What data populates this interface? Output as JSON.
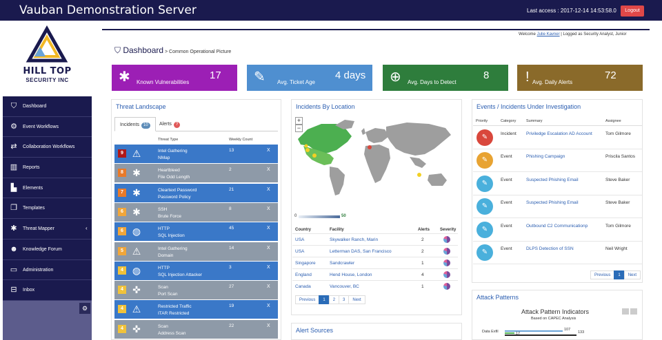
{
  "header": {
    "title": "Vauban Demonstration Server",
    "last_access": "Last access : 2017-12-14 14:53:58.0",
    "logout_label": "Logout"
  },
  "logo": {
    "line1": "HILL TOP",
    "line2": "SECURITY INC"
  },
  "sidebar": {
    "items": [
      {
        "label": "Dashboard",
        "icon": "shield-icon"
      },
      {
        "label": "Event Workflows",
        "icon": "cogs-icon"
      },
      {
        "label": "Collaboration Workflows",
        "icon": "exchange-icon"
      },
      {
        "label": "Reports",
        "icon": "bar-chart-icon"
      },
      {
        "label": "Elements",
        "icon": "sitemap-icon"
      },
      {
        "label": "Templates",
        "icon": "copy-icon"
      },
      {
        "label": "Threat Mapper",
        "icon": "bug-icon"
      },
      {
        "label": "Knowledge Forum",
        "icon": "users-icon"
      },
      {
        "label": "Administration",
        "icon": "desktop-icon"
      },
      {
        "label": "Inbox",
        "icon": "inbox-icon"
      }
    ]
  },
  "welcome": {
    "prefix": "Welcome ",
    "user": "Julie Kavner",
    "suffix": " | Logged as Security Analyst, Junior"
  },
  "breadcrumb": {
    "title": "Dashboard",
    "sub": " > Common Operational Picture"
  },
  "tiles": [
    {
      "label": "Known Vulnerabilities",
      "value": "17",
      "color": "#9c1fb5",
      "icon": "bug-icon"
    },
    {
      "label": "Avg. Ticket Age",
      "value": "4 days",
      "color": "#4f8fd0",
      "icon": "ticket-icon"
    },
    {
      "label": "Avg. Days to Detect",
      "value": "8",
      "color": "#2e7d3c",
      "icon": "search-plus-icon"
    },
    {
      "label": "Avg. Daily Alerts",
      "value": "72",
      "color": "#8a6a2a",
      "icon": "exclamation-icon"
    }
  ],
  "threat_landscape": {
    "title": "Threat Landscape",
    "tabs": [
      {
        "label": "Incidents",
        "badge": "10"
      },
      {
        "label": "Alerts",
        "badge": "?"
      }
    ],
    "col_threat_type": "Threat Type",
    "col_weekly_count": "Weekly Count",
    "rows": [
      {
        "num": "9",
        "line1": "Intel Gathering",
        "line2": "NMap",
        "count": "13",
        "row_color": "#3a78c8",
        "num_color": "#b01818",
        "icon": "warning-icon"
      },
      {
        "num": "8",
        "line1": "Heartbleed",
        "line2": "File Odd Length",
        "count": "2",
        "row_color": "#8e9aa8",
        "num_color": "#e87a2a",
        "icon": "bug-icon"
      },
      {
        "num": "7",
        "line1": "Cleartext Password",
        "line2": "Password Policy",
        "count": "21",
        "row_color": "#3a78c8",
        "num_color": "#e87a2a",
        "icon": "asterisk-icon"
      },
      {
        "num": "6",
        "line1": "SSH",
        "line2": "Brute Force",
        "count": "8",
        "row_color": "#8e9aa8",
        "num_color": "#f0a63a",
        "icon": "asterisk-icon"
      },
      {
        "num": "6",
        "line1": "HTTP",
        "line2": "SQL Injection",
        "count": "45",
        "row_color": "#3a78c8",
        "num_color": "#f0a63a",
        "icon": "globe-icon"
      },
      {
        "num": "5",
        "line1": "Intel Gathering",
        "line2": "Domain",
        "count": "14",
        "row_color": "#8e9aa8",
        "num_color": "#f0a63a",
        "icon": "warning-icon"
      },
      {
        "num": "4",
        "line1": "HTTP",
        "line2": "SQL Injection Attacker",
        "count": "3",
        "row_color": "#3a78c8",
        "num_color": "#f0c23a",
        "icon": "globe-icon"
      },
      {
        "num": "4",
        "line1": "Scan",
        "line2": "Port Scan",
        "count": "27",
        "row_color": "#8e9aa8",
        "num_color": "#f0c23a",
        "icon": "crosshairs-icon"
      },
      {
        "num": "4",
        "line1": "Restricted Traffic",
        "line2": "ITAR Restricted",
        "count": "19",
        "row_color": "#3a78c8",
        "num_color": "#f0c23a",
        "icon": "warning-icon"
      },
      {
        "num": "4",
        "line1": "Scan",
        "line2": "Address Scan",
        "count": "22",
        "row_color": "#8e9aa8",
        "num_color": "#f0c23a",
        "icon": "crosshairs-icon"
      }
    ],
    "close_glyph": "X"
  },
  "incidents_by_location": {
    "title": "Incidents By Location",
    "zoom_in": "+",
    "zoom_out": "−",
    "legend_min": "0",
    "legend_max": "50",
    "columns": [
      "Country",
      "Facility",
      "Alerts",
      "Severity"
    ],
    "rows": [
      {
        "country": "USA",
        "facility": "Skywalker Ranch, Marin",
        "alerts": "2"
      },
      {
        "country": "USA",
        "facility": "Letterman DAS, San Francisco",
        "alerts": "2"
      },
      {
        "country": "Singapore",
        "facility": "Sandcrawler",
        "alerts": "1"
      },
      {
        "country": "England",
        "facility": "Hend House, London",
        "alerts": "4"
      },
      {
        "country": "Canada",
        "facility": "Vancouver, BC",
        "alerts": "1"
      }
    ],
    "pager": {
      "prev": "Previous",
      "pages": [
        "1",
        "2",
        "3"
      ],
      "next": "Next"
    }
  },
  "alert_sources": {
    "title": "Alert Sources"
  },
  "events": {
    "title": "Events / Incidents Under Investigation",
    "columns": [
      "Priority",
      "Category",
      "Summary",
      "Assignee"
    ],
    "rows": [
      {
        "category": "Incident",
        "summary": "Priviledge Escalation AD Account",
        "assignee": "Tom Gilmore",
        "color": "#d9473c"
      },
      {
        "category": "Event",
        "summary": "Phishing Campaign",
        "assignee": "Priscila Santos",
        "color": "#e8a332"
      },
      {
        "category": "Event",
        "summary": "Suspected Phishing Email",
        "assignee": "Steve Baker",
        "color": "#4ab0dc"
      },
      {
        "category": "Event",
        "summary": "Suspected Phishing Email",
        "assignee": "Steve Baker",
        "color": "#4ab0dc"
      },
      {
        "category": "Event",
        "summary": "Outbound C2 Communicationp",
        "assignee": "Tom Gilmore",
        "color": "#4ab0dc"
      },
      {
        "category": "Event",
        "summary": "DLPS Detection of SSN",
        "assignee": "Neil Wright",
        "color": "#4ab0dc"
      }
    ],
    "pager": {
      "prev": "Previous",
      "page": "1",
      "next": "Next"
    }
  },
  "attack_patterns": {
    "title": "Attack Patterns",
    "chart_title": "Attack Pattern Indicators",
    "chart_subtitle": "Based on CAPEC Analysis",
    "row_label": "Data Exfil",
    "values": [
      "107",
      "17",
      "133"
    ]
  },
  "colors": {
    "navy": "#1a1a4e",
    "link": "#2a5db0",
    "logout": "#e04848"
  }
}
